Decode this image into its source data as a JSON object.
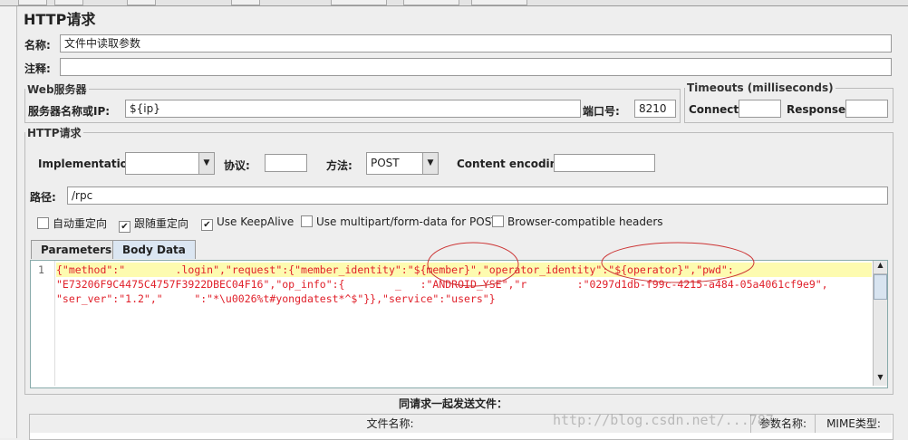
{
  "panel_title": "HTTP请求",
  "name": {
    "label": "名称:",
    "value": "文件中读取参数"
  },
  "comment": {
    "label": "注释:",
    "value": ""
  },
  "web_server": {
    "legend": "Web服务器",
    "server_label": "服务器名称或IP:",
    "server_value": "${ip}",
    "port_label": "端口号:",
    "port_value": "8210"
  },
  "timeouts": {
    "legend": "Timeouts (milliseconds)",
    "connect_label": "Connect:",
    "connect_value": "",
    "response_label": "Response:",
    "response_value": ""
  },
  "http_request": {
    "legend": "HTTP请求",
    "impl_label": "Implementation:",
    "impl_value": "",
    "protocol_label": "协议:",
    "protocol_value": "",
    "method_label": "方法:",
    "method_value": "POST",
    "encoding_label": "Content encoding:",
    "encoding_value": "",
    "path_label": "路径:",
    "path_value": "/rpc"
  },
  "options": [
    {
      "label": "自动重定向",
      "checked": false
    },
    {
      "label": "跟随重定向",
      "checked": true
    },
    {
      "label": "Use KeepAlive",
      "checked": true
    },
    {
      "label": "Use multipart/form-data for POST",
      "checked": false
    },
    {
      "label": "Browser-compatible headers",
      "checked": false
    }
  ],
  "tabs": [
    {
      "label": "Parameters"
    },
    {
      "label": "Body Data"
    }
  ],
  "body": {
    "line_number": "1",
    "lines": [
      "{\"method\":\"        .login\",\"request\":{\"member_identity\":\"${member}\",\"operator_identity\":\"${operator}\",\"pwd\":",
      "\"E73206F9C4475C4757F3922DBEC04F16\",\"op_info\":{        _   :\"ANDROID_YSE\",\"r        :\"0297d1db-f99c-4215-a484-05a4061cf9e9\",",
      "\"ser_ver\":\"1.2\",\"     \":\"*\\u0026%t#yongdatest*^$\"}},\"service\":\"users\"}"
    ]
  },
  "files": {
    "title": "同请求一起发送文件：",
    "col_filename": "文件名称:",
    "col_param": "参数名称:",
    "col_mime": "MIME类型:"
  },
  "watermark": "http://blog.csdn.net/...787"
}
